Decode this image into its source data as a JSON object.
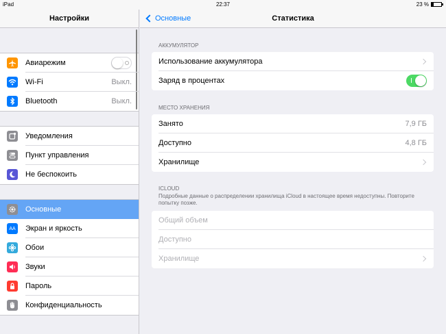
{
  "statusbar": {
    "device": "iPad",
    "time": "22:37",
    "battery_text": "23 %",
    "battery_level": 0.23
  },
  "sidebar": {
    "title": "Настройки",
    "groups": [
      [
        {
          "label": "Авиарежим",
          "icon": "airplane-icon",
          "color": "#ff9500",
          "toggle": "off"
        },
        {
          "label": "Wi-Fi",
          "icon": "wifi-icon",
          "color": "#007aff",
          "value": "Выкл."
        },
        {
          "label": "Bluetooth",
          "icon": "bluetooth-icon",
          "color": "#007aff",
          "value": "Выкл."
        }
      ],
      [
        {
          "label": "Уведомления",
          "icon": "notifications-icon",
          "color": "#8e8e93"
        },
        {
          "label": "Пункт управления",
          "icon": "control-center-icon",
          "color": "#8e8e93"
        },
        {
          "label": "Не беспокоить",
          "icon": "moon-icon",
          "color": "#5856d6"
        }
      ],
      [
        {
          "label": "Основные",
          "icon": "gear-icon",
          "color": "#8e8e93",
          "active": true
        },
        {
          "label": "Экран и яркость",
          "icon": "display-brightness-icon",
          "color": "#007aff"
        },
        {
          "label": "Обои",
          "icon": "wallpaper-icon",
          "color": "#34aadc"
        },
        {
          "label": "Звуки",
          "icon": "sound-icon",
          "color": "#ff2d55"
        },
        {
          "label": "Пароль",
          "icon": "lock-icon",
          "color": "#ff3b30"
        },
        {
          "label": "Конфиденциальность",
          "icon": "hand-icon",
          "color": "#8e8e93"
        }
      ]
    ]
  },
  "nav": {
    "back_label": "Основные",
    "title": "Статистика"
  },
  "battery_section": {
    "header": "АККУМУЛЯТОР",
    "usage_label": "Использование аккумулятора",
    "percent_label": "Заряд в процентах",
    "percent_toggle": "on"
  },
  "storage_section": {
    "header": "МЕСТО ХРАНЕНИЯ",
    "used_label": "Занято",
    "used_value": "7,9 ГБ",
    "available_label": "Доступно",
    "available_value": "4,8 ГБ",
    "storage_label": "Хранилище"
  },
  "icloud_section": {
    "header": "ICLOUD",
    "note": "Подробные данные о распределении хранилища iCloud в настоящее время недоступны. Повторите попытку позже.",
    "total_label": "Общий объем",
    "available_label": "Доступно",
    "storage_label": "Хранилище"
  },
  "colors": {
    "accent": "#007aff",
    "toggle_on": "#4cd964",
    "selected": "#64a5f5"
  }
}
